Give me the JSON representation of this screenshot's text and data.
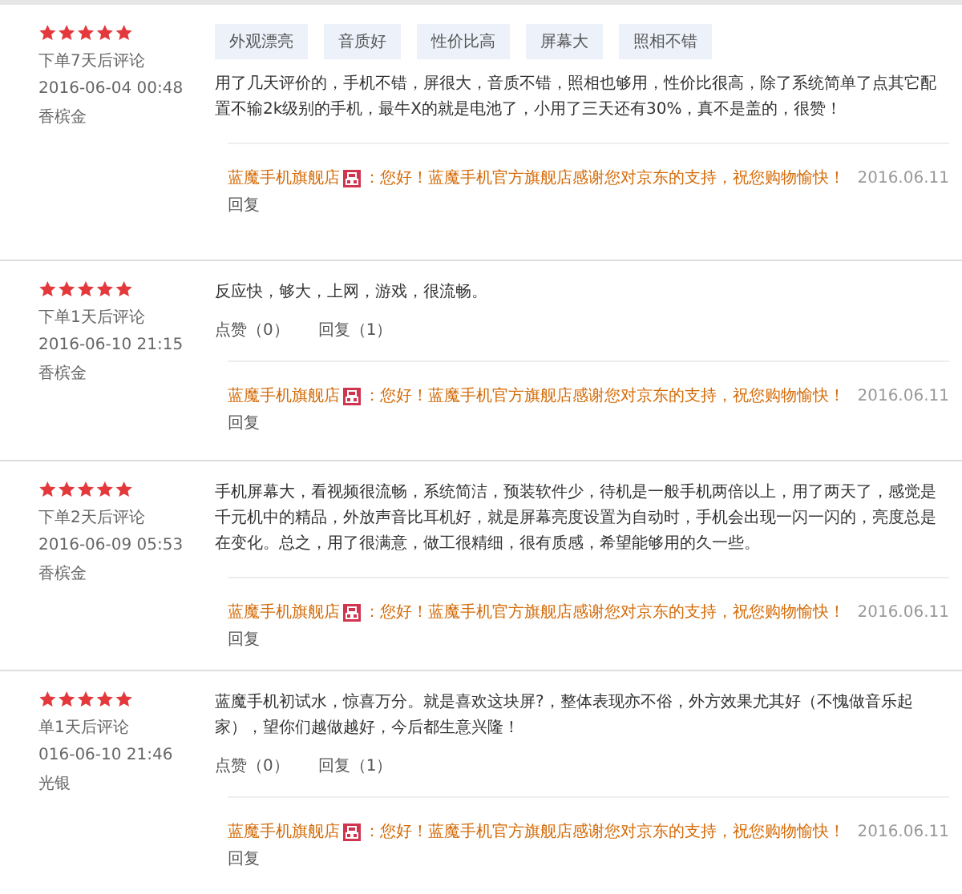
{
  "reviews": [
    {
      "stars": 5,
      "order_note": "下单7天后评论",
      "time": "2016-06-04 00:48",
      "variant": "香槟金",
      "tags": [
        "外观漂亮",
        "音质好",
        "性价比高",
        "屏幕大",
        "照相不错"
      ],
      "content": "用了几天评价的，手机不错，屏很大，音质不错，照相也够用，性价比很高，除了系统简单了点其它配置不输2k级别的手机，最牛X的就是电池了，小用了三天还有30%，真不是盖的，很赞！",
      "shop_reply": {
        "shop": "蓝魔手机旗舰店",
        "text": "：您好！蓝魔手机官方旗舰店感谢您对京东的支持，祝您购物愉快！",
        "date": "2016.06.11",
        "reply": "回复"
      }
    },
    {
      "stars": 5,
      "order_note": "下单1天后评论",
      "time": "2016-06-10 21:15",
      "variant": "香槟金",
      "content": "反应快，够大，上网，游戏，很流畅。",
      "actions": {
        "like": "点赞（0）",
        "reply": "回复（1）"
      },
      "shop_reply": {
        "shop": "蓝魔手机旗舰店",
        "text": "：您好！蓝魔手机官方旗舰店感谢您对京东的支持，祝您购物愉快！",
        "date": "2016.06.11",
        "reply": "回复"
      }
    },
    {
      "stars": 5,
      "order_note": "下单2天后评论",
      "time": "2016-06-09 05:53",
      "variant": "香槟金",
      "content": "手机屏幕大，看视频很流畅，系统简洁，预装软件少，待机是一般手机两倍以上，用了两天了，感觉是千元机中的精品，外放声音比耳机好，就是屏幕亮度设置为自动时，手机会出现一闪一闪的，亮度总是在变化。总之，用了很满意，做工很精细，很有质感，希望能够用的久一些。",
      "shop_reply": {
        "shop": "蓝魔手机旗舰店",
        "text": "：您好！蓝魔手机官方旗舰店感谢您对京东的支持，祝您购物愉快！",
        "date": "2016.06.11",
        "reply": "回复"
      }
    },
    {
      "stars": 5,
      "order_note": "单1天后评论",
      "time": "016-06-10 21:46",
      "variant": "光银",
      "content": "蓝魔手机初试水，惊喜万分。就是喜欢这块屏?，整体表现亦不俗，外方效果尤其好（不愧做音乐起家），望你们越做越好，今后都生意兴隆！",
      "actions": {
        "like": "点赞（0）",
        "reply": "回复（1）"
      },
      "shop_reply": {
        "shop": "蓝魔手机旗舰店",
        "text": "：您好！蓝魔手机官方旗舰店感谢您对京东的支持，祝您购物愉快！",
        "date": "2016.06.11",
        "reply": "回复"
      }
    }
  ]
}
